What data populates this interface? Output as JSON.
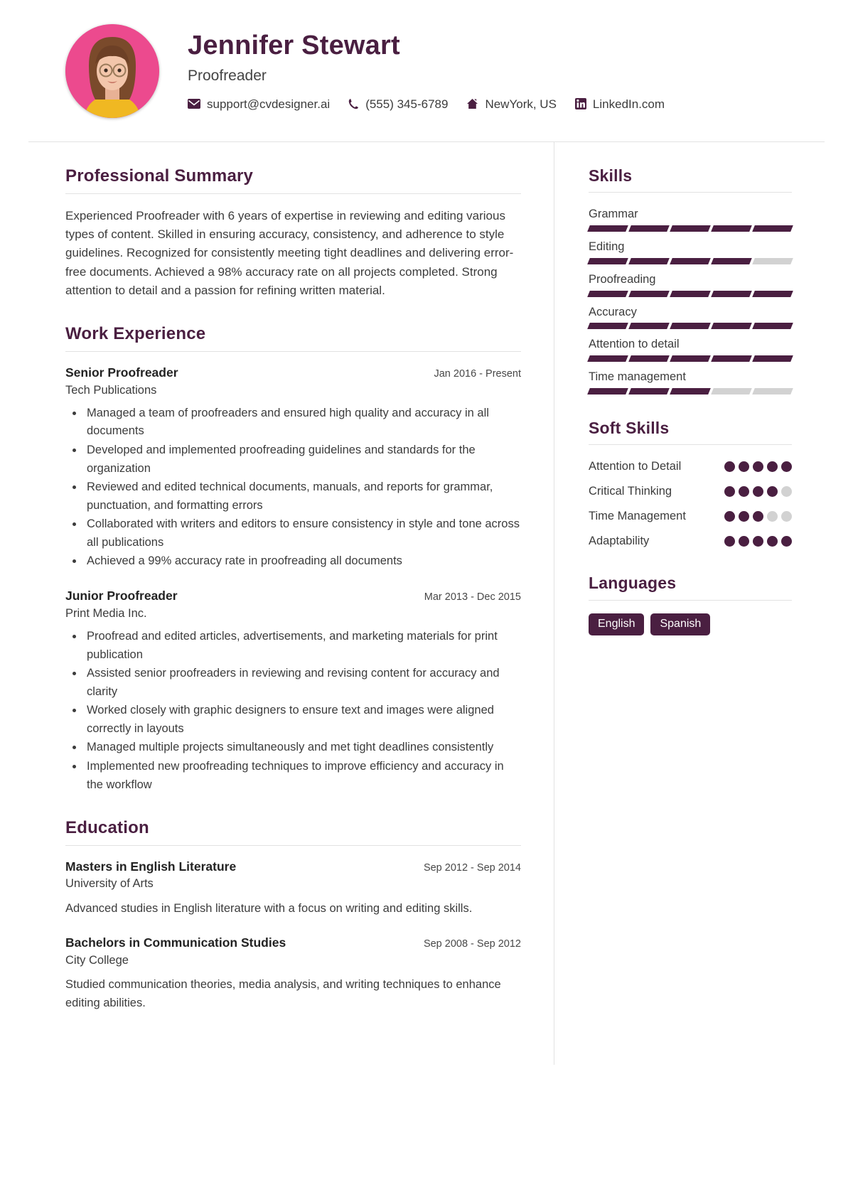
{
  "header": {
    "name": "Jennifer Stewart",
    "job_title": "Proofreader",
    "avatar_alt": "profile-photo",
    "contacts": [
      {
        "icon": "envelope-icon",
        "text": "support@cvdesigner.ai"
      },
      {
        "icon": "phone-icon",
        "text": "(555) 345-6789"
      },
      {
        "icon": "home-icon",
        "text": "NewYork, US"
      },
      {
        "icon": "linkedin-icon",
        "text": "LinkedIn.com"
      }
    ]
  },
  "main": {
    "summary": {
      "title": "Professional Summary",
      "text": "Experienced Proofreader with 6 years of expertise in reviewing and editing various types of content. Skilled in ensuring accuracy, consistency, and adherence to style guidelines. Recognized for consistently meeting tight deadlines and delivering error-free documents. Achieved a 98% accuracy rate on all projects completed. Strong attention to detail and a passion for refining written material."
    },
    "experience": {
      "title": "Work Experience",
      "entries": [
        {
          "role": "Senior Proofreader",
          "dates": "Jan 2016 - Present",
          "org": "Tech Publications",
          "bullets": [
            "Managed a team of proofreaders and ensured high quality and accuracy in all documents",
            "Developed and implemented proofreading guidelines and standards for the organization",
            "Reviewed and edited technical documents, manuals, and reports for grammar, punctuation, and formatting errors",
            "Collaborated with writers and editors to ensure consistency in style and tone across all publications",
            "Achieved a 99% accuracy rate in proofreading all documents"
          ]
        },
        {
          "role": "Junior Proofreader",
          "dates": "Mar 2013 - Dec 2015",
          "org": "Print Media Inc.",
          "bullets": [
            "Proofread and edited articles, advertisements, and marketing materials for print publication",
            "Assisted senior proofreaders in reviewing and revising content for accuracy and clarity",
            "Worked closely with graphic designers to ensure text and images were aligned correctly in layouts",
            "Managed multiple projects simultaneously and met tight deadlines consistently",
            "Implemented new proofreading techniques to improve efficiency and accuracy in the workflow"
          ]
        }
      ]
    },
    "education": {
      "title": "Education",
      "entries": [
        {
          "degree": "Masters in English Literature",
          "dates": "Sep 2012 - Sep 2014",
          "school": "University of Arts",
          "description": "Advanced studies in English literature with a focus on writing and editing skills."
        },
        {
          "degree": "Bachelors in Communication Studies",
          "dates": "Sep 2008 - Sep 2012",
          "school": "City College",
          "description": "Studied communication theories, media analysis, and writing techniques to enhance editing abilities."
        }
      ]
    }
  },
  "sidebar": {
    "skills": {
      "title": "Skills",
      "segments_total": 5,
      "items": [
        {
          "label": "Grammar",
          "filled": 5
        },
        {
          "label": "Editing",
          "filled": 4
        },
        {
          "label": "Proofreading",
          "filled": 5
        },
        {
          "label": "Accuracy",
          "filled": 5
        },
        {
          "label": "Attention to detail",
          "filled": 5
        },
        {
          "label": "Time management",
          "filled": 3
        }
      ]
    },
    "soft_skills": {
      "title": "Soft Skills",
      "dots_total": 5,
      "items": [
        {
          "label": "Attention to Detail",
          "filled": 5
        },
        {
          "label": "Critical Thinking",
          "filled": 4
        },
        {
          "label": "Time Management",
          "filled": 3
        },
        {
          "label": "Adaptability",
          "filled": 5
        }
      ]
    },
    "languages": {
      "title": "Languages",
      "items": [
        "English",
        "Spanish"
      ]
    }
  },
  "colors": {
    "accent": "#4a1f41",
    "muted_bar": "#d2d2d2",
    "rule": "#e2e2e2",
    "avatar_bg": "#ec4a8e",
    "text": "#3c3c3c"
  }
}
